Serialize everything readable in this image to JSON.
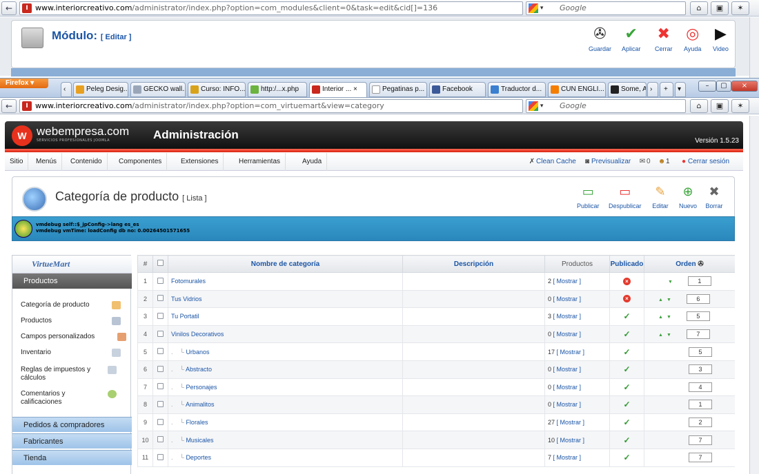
{
  "bg_window": {
    "url_host": "www.interiorcreativo.com",
    "url_path": "/administrator/index.php?option=com_modules&client=0&task=edit&cid[]=136",
    "search_engine": "Google",
    "module_title": "Módulo:",
    "module_sub": "[ Editar ]",
    "toolbar": [
      {
        "label": "Guardar",
        "icon": "save-icon"
      },
      {
        "label": "Aplicar",
        "icon": "apply-icon"
      },
      {
        "label": "Cerrar",
        "icon": "close-icon"
      },
      {
        "label": "Ayuda",
        "icon": "help-icon"
      },
      {
        "label": "Video",
        "icon": "video-icon"
      }
    ]
  },
  "firefox": {
    "button_label": "Firefox",
    "tabs": [
      {
        "label": "Peleg Desig...",
        "color": "#e8a020"
      },
      {
        "label": "GECKO wall...",
        "color": "#9aa6b8"
      },
      {
        "label": "Curso: INFO...",
        "color": "#d8a31a"
      },
      {
        "label": "http:/...x.php",
        "color": "#6cb33f"
      },
      {
        "label": "Interior ...",
        "color": "#c8281e",
        "active": true
      },
      {
        "label": "Pegatinas p...",
        "color": "#bbbbbb"
      },
      {
        "label": "Facebook",
        "color": "#3b5998"
      },
      {
        "label": "Traductor d...",
        "color": "#3a7fd0"
      },
      {
        "label": "CUN ENGLI...",
        "color": "#f57d00"
      },
      {
        "label": "Some, A",
        "color": "#222222"
      }
    ]
  },
  "fg_window": {
    "url_host": "www.interiorcreativo.com",
    "url_path": "/administrator/index.php?option=com_virtuemart&view=category",
    "search_engine": "Google"
  },
  "admin": {
    "logo_text": "webempresa.com",
    "logo_sub": "SERVICIOS PROFESIONALES JOOMLA",
    "title": "Administración",
    "version": "Versión 1.5.23",
    "menu": [
      "Sitio",
      "Menús",
      "Contenido",
      "Componentes",
      "Extensiones",
      "Herramientas",
      "Ayuda"
    ],
    "clean_cache": "Clean Cache",
    "preview": "Previsualizar",
    "msgs": "0",
    "users": "1",
    "logout": "Cerrar sesión"
  },
  "page": {
    "title": "Categoría de producto",
    "sub": "[ Lista ]",
    "toolbar": [
      {
        "label": "Publicar",
        "icon": "publish-icon"
      },
      {
        "label": "Despublicar",
        "icon": "unpublish-icon"
      },
      {
        "label": "Editar",
        "icon": "edit-icon"
      },
      {
        "label": "Nuevo",
        "icon": "new-icon"
      },
      {
        "label": "Borrar",
        "icon": "delete-icon"
      }
    ],
    "debug1": "vmdebug self::$_jpConfig->lang es_es",
    "debug2": "vmdebug vmTime: loadConfig db no: 0.00264501571655"
  },
  "sidebar": {
    "logo": "VirtueMart",
    "section": "Productos",
    "items": [
      "Categoría de producto",
      "Productos",
      "Campos personalizados",
      "Inventario",
      "Reglas de impuestos y cálculos",
      "Comentarios y calificaciones"
    ],
    "sections": [
      "Pedidos & compradores",
      "Fabricantes",
      "Tienda"
    ]
  },
  "table": {
    "headers": {
      "num": "#",
      "name": "Nombre de categoría",
      "desc": "Descripción",
      "products": "Productos",
      "published": "Publicado",
      "order": "Orden"
    },
    "mostrar": "[ Mostrar ]",
    "rows": [
      {
        "n": "1",
        "name": "Fotomurales",
        "child": false,
        "count": "2",
        "pub": false,
        "up": false,
        "down": true,
        "order": "1"
      },
      {
        "n": "2",
        "name": "Tus Vidrios",
        "child": false,
        "count": "0",
        "pub": false,
        "up": true,
        "down": true,
        "order": "6"
      },
      {
        "n": "3",
        "name": "Tu Portatil",
        "child": false,
        "count": "3",
        "pub": true,
        "up": true,
        "down": true,
        "order": "5"
      },
      {
        "n": "4",
        "name": "Vinilos Decorativos",
        "child": false,
        "count": "0",
        "pub": true,
        "up": true,
        "down": true,
        "order": "7"
      },
      {
        "n": "5",
        "name": "Urbanos",
        "child": true,
        "count": "17",
        "pub": true,
        "up": false,
        "down": false,
        "order": "5"
      },
      {
        "n": "6",
        "name": "Abstracto",
        "child": true,
        "count": "0",
        "pub": true,
        "up": false,
        "down": false,
        "order": "3"
      },
      {
        "n": "7",
        "name": "Personajes",
        "child": true,
        "count": "0",
        "pub": true,
        "up": false,
        "down": false,
        "order": "4"
      },
      {
        "n": "8",
        "name": "Animalitos",
        "child": true,
        "count": "0",
        "pub": true,
        "up": false,
        "down": false,
        "order": "1"
      },
      {
        "n": "9",
        "name": "Florales",
        "child": true,
        "count": "27",
        "pub": true,
        "up": false,
        "down": false,
        "order": "2"
      },
      {
        "n": "10",
        "name": "Musicales",
        "child": true,
        "count": "10",
        "pub": true,
        "up": false,
        "down": false,
        "order": "7"
      },
      {
        "n": "11",
        "name": "Deportes",
        "child": true,
        "count": "7",
        "pub": true,
        "up": false,
        "down": false,
        "order": "7"
      }
    ]
  }
}
